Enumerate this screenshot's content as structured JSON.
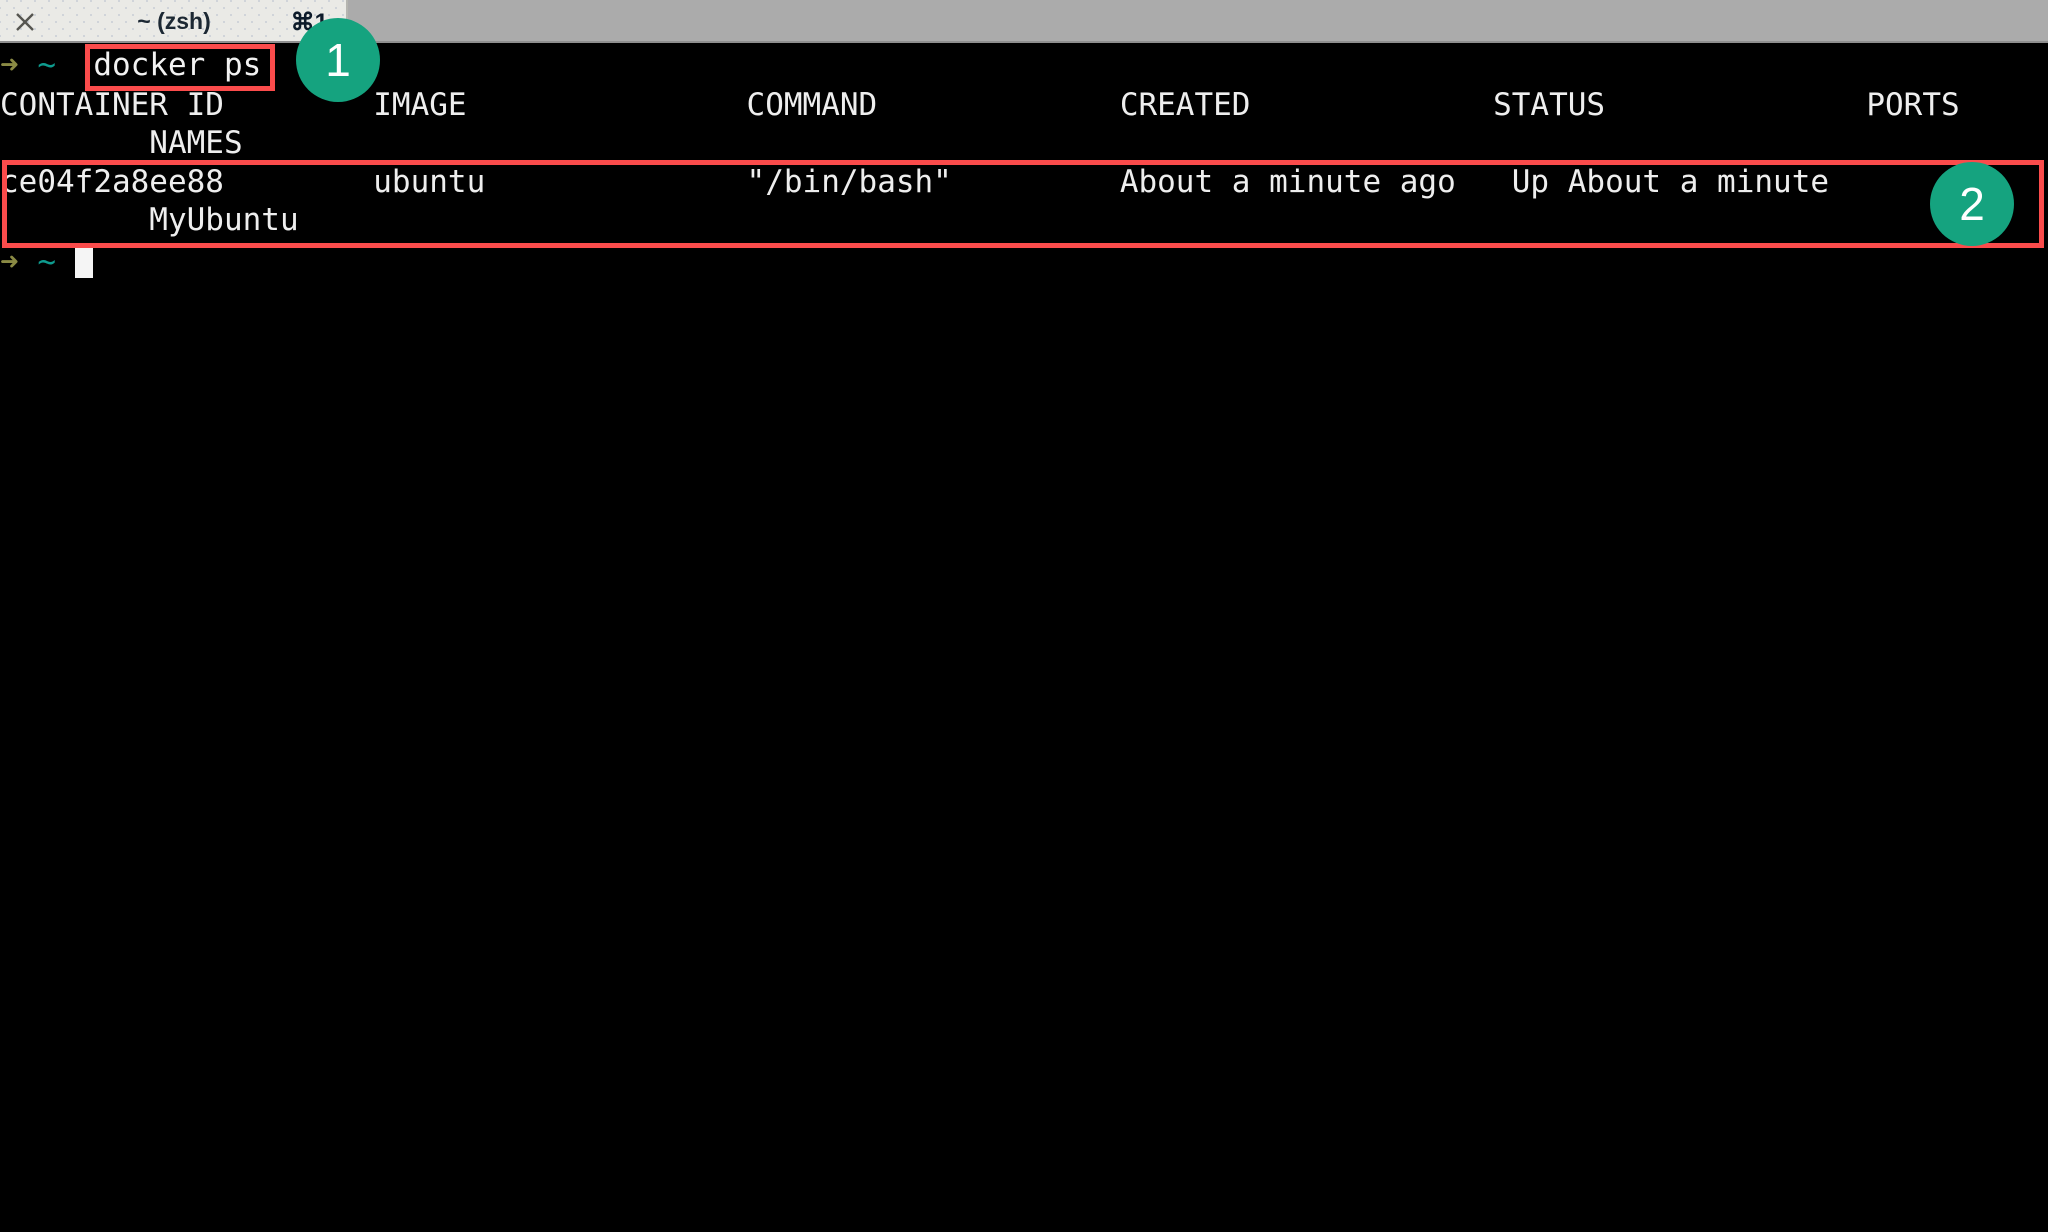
{
  "window": {
    "tabbar": {
      "close_icon": "close-icon",
      "tab_title": "~ (zsh)",
      "tab_shortcut": "⌘1"
    }
  },
  "terminal": {
    "prompt": {
      "arrow": "➜",
      "cwd": "~"
    },
    "command": "docker ps",
    "columns": [
      "CONTAINER ID",
      "IMAGE",
      "COMMAND",
      "CREATED",
      "STATUS",
      "PORTS",
      "NAMES"
    ],
    "header_line_1": "CONTAINER ID        IMAGE               COMMAND             CREATED             STATUS              PORTS",
    "header_line_2": "        NAMES",
    "row_line_1": "ce04f2a8ee88        ubuntu              \"/bin/bash\"         About a minute ago   Up About a minute",
    "row_line_2": "        MyUbuntu",
    "row": {
      "container_id": "ce04f2a8ee88",
      "image": "ubuntu",
      "command": "\"/bin/bash\"",
      "created": "About a minute ago",
      "status": "Up About a minute",
      "ports": "",
      "names": "MyUbuntu"
    }
  },
  "annotations": {
    "accent_color": "#15A37F",
    "highlight_color": "#FA4B4B",
    "badge_1": "1",
    "badge_2": "2"
  }
}
